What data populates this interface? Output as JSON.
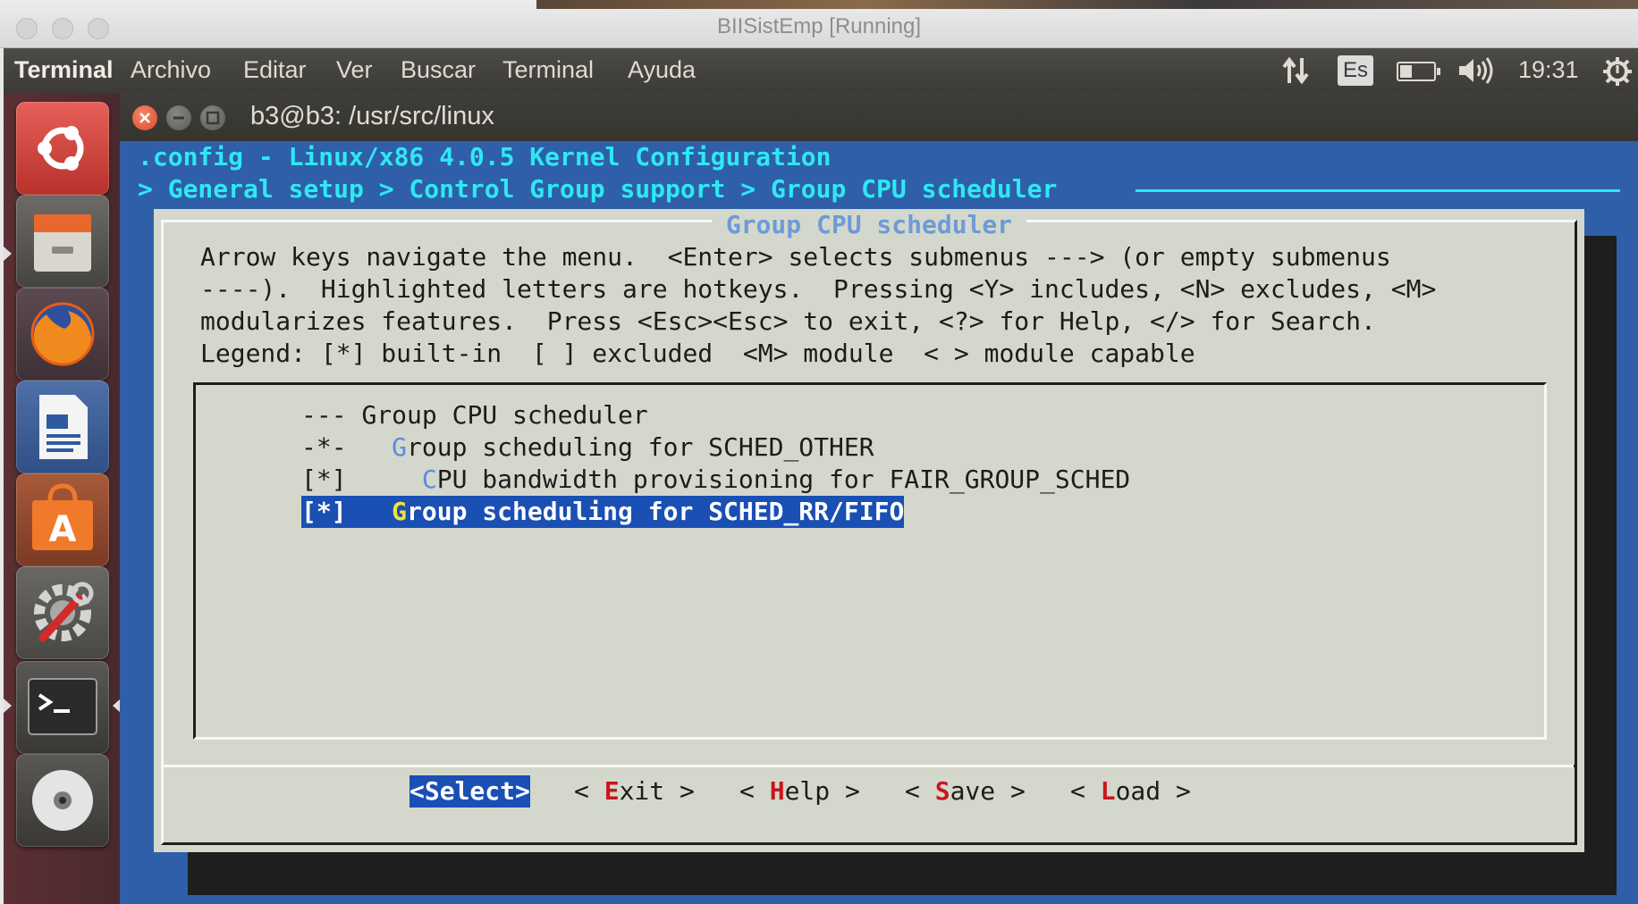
{
  "host": {
    "title": "BIISistEmp [Running]"
  },
  "panel": {
    "app_name": "Terminal",
    "menus": [
      "Archivo",
      "Editar",
      "Ver",
      "Buscar",
      "Terminal",
      "Ayuda"
    ],
    "language": "Es",
    "time": "19:31",
    "battery_level": 0.35
  },
  "launcher": {
    "items": [
      "ubuntu-dash-icon",
      "files-icon",
      "firefox-icon",
      "libreoffice-writer-icon",
      "software-center-icon",
      "system-settings-icon",
      "terminal-icon",
      "dvd-icon"
    ]
  },
  "terminal": {
    "title": "b3@b3: /usr/src/linux",
    "header": ".config - Linux/x86 4.0.5 Kernel Configuration",
    "breadcrumb": "> General setup > Control Group support > Group CPU scheduler"
  },
  "dialog": {
    "title": "Group CPU scheduler",
    "help_lines": [
      "Arrow keys navigate the menu.  <Enter> selects submenus ---> (or empty submenus",
      "----).  Highlighted letters are hotkeys.  Pressing <Y> includes, <N> excludes, <M>",
      "modularizes features.  Press <Esc><Esc> to exit, <?> for Help, </> for Search.",
      "Legend: [*] built-in  [ ] excluded  <M> module  < > module capable"
    ],
    "menu_items": [
      {
        "prefix": "--- ",
        "hotkey": "",
        "rest": "Group CPU scheduler"
      },
      {
        "prefix": "-*-   ",
        "hotkey": "G",
        "rest": "roup scheduling for SCHED_OTHER"
      },
      {
        "prefix": "[*]     ",
        "hotkey": "C",
        "rest": "PU bandwidth provisioning for FAIR_GROUP_SCHED"
      },
      {
        "prefix": "[*]   ",
        "hotkey": "G",
        "rest": "roup scheduling for SCHED_RR/FIFO"
      }
    ],
    "selected_index": 3,
    "buttons": [
      {
        "pre": "<",
        "hotkey": "S",
        "rest": "elect>"
      },
      {
        "pre": "< ",
        "hotkey": "E",
        "rest": "xit >"
      },
      {
        "pre": "< ",
        "hotkey": "H",
        "rest": "elp >"
      },
      {
        "pre": "< ",
        "hotkey": "S",
        "rest": "ave >"
      },
      {
        "pre": "< ",
        "hotkey": "L",
        "rest": "oad >"
      }
    ]
  },
  "colors": {
    "terminal_bg": "#2f5fa8",
    "header_cyan": "#2ee8f4",
    "dialog_bg": "#d4d8cc",
    "selection": "#1a4fb4",
    "hotkey_red": "#c8161b",
    "hotkey_yellow": "#f2e33a"
  }
}
